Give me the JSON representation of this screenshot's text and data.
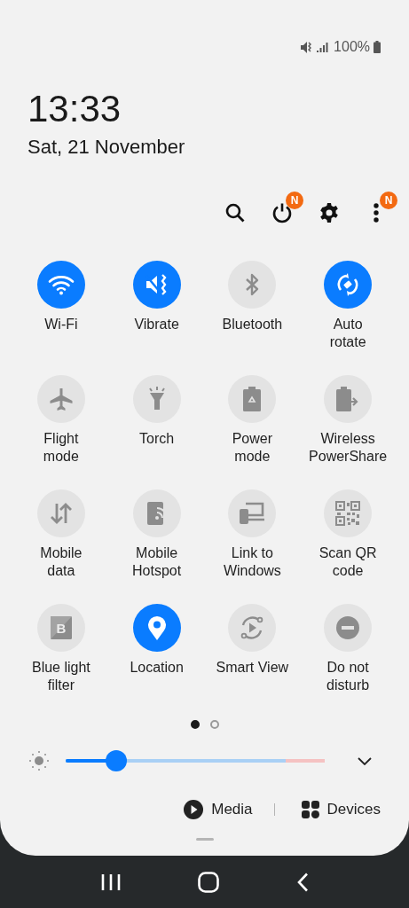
{
  "status_bar": {
    "battery": "100%"
  },
  "clock": {
    "time": "13:33",
    "date": "Sat, 21 November"
  },
  "toolbar": [
    {
      "kind": "search"
    },
    {
      "kind": "power",
      "badge": "N"
    },
    {
      "kind": "settings"
    },
    {
      "kind": "more",
      "badge": "N"
    }
  ],
  "tiles": [
    {
      "kind": "wifi",
      "label": "Wi-Fi",
      "on": true
    },
    {
      "kind": "vibrate",
      "label": "Vibrate",
      "on": true
    },
    {
      "kind": "bluetooth",
      "label": "Bluetooth",
      "on": false
    },
    {
      "kind": "rotate",
      "label": "Auto\nrotate",
      "on": true
    },
    {
      "kind": "airplane",
      "label": "Flight\nmode",
      "on": false
    },
    {
      "kind": "torch",
      "label": "Torch",
      "on": false
    },
    {
      "kind": "power-mode",
      "label": "Power\nmode",
      "on": false
    },
    {
      "kind": "powershare",
      "label": "Wireless\nPowerShare",
      "on": false
    },
    {
      "kind": "data",
      "label": "Mobile\ndata",
      "on": false
    },
    {
      "kind": "hotspot",
      "label": "Mobile\nHotspot",
      "on": false
    },
    {
      "kind": "link",
      "label": "Link to\nWindows",
      "on": false
    },
    {
      "kind": "qr",
      "label": "Scan QR\ncode",
      "on": false
    },
    {
      "kind": "bluelight",
      "label": "Blue light\nfilter",
      "on": false,
      "glyph": "B"
    },
    {
      "kind": "location",
      "label": "Location",
      "on": true
    },
    {
      "kind": "smartview",
      "label": "Smart View",
      "on": false
    },
    {
      "kind": "dnd",
      "label": "Do not\ndisturb",
      "on": false
    }
  ],
  "pages": [
    {
      "selected": true
    },
    {
      "selected": false
    }
  ],
  "brightness": {
    "level": 0.18
  },
  "shortcuts": [
    {
      "kind": "media",
      "label": "Media"
    },
    {
      "kind": "devices",
      "label": "Devices"
    }
  ]
}
